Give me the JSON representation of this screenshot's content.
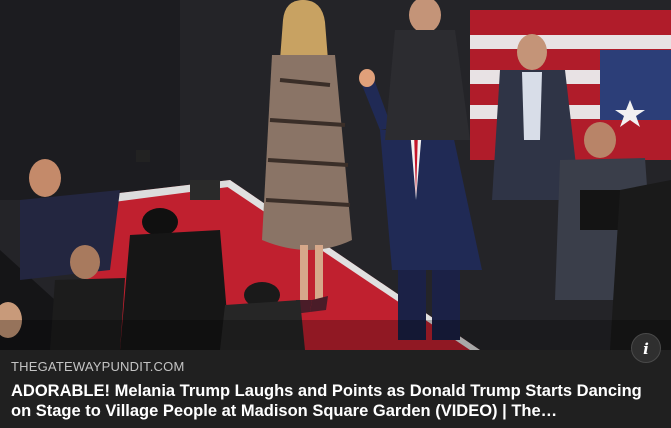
{
  "image": {
    "subject": "stage-photo",
    "palette": {
      "stage": "#c0202f",
      "backdrop": "#242428",
      "flag_red": "#b01c2a",
      "flag_blue": "#2c3e78"
    }
  },
  "info_button": {
    "icon": "info-icon",
    "glyph": "i"
  },
  "caption": {
    "source": "THEGATEWAYPUNDIT.COM",
    "headline": "ADORABLE! Melania Trump Laughs and Points as Donald Trump Starts Dancing on Stage to Village People at Madison Square Garden (VIDEO) | The…"
  }
}
